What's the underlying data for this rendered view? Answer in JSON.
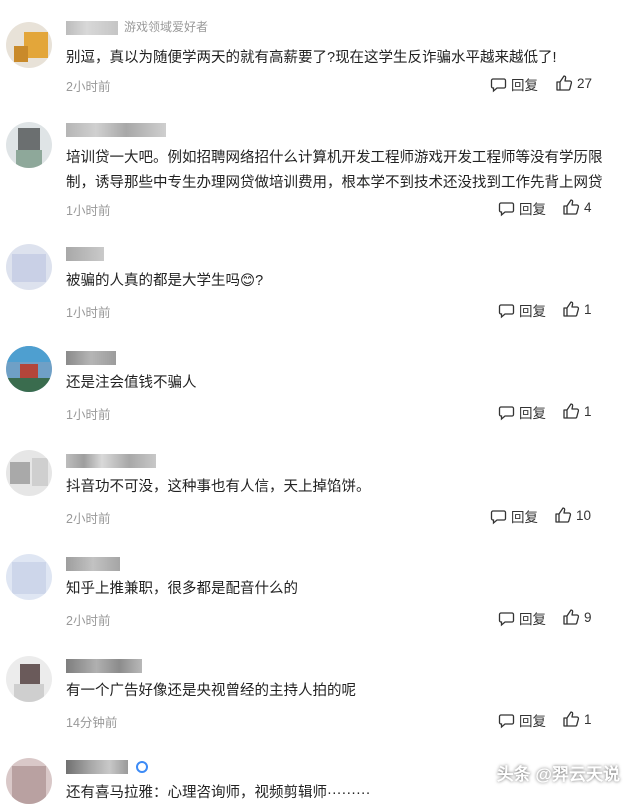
{
  "ui": {
    "reply_label": "回复"
  },
  "comments": [
    {
      "tag": "游戏领域爱好者",
      "text": "别逗，真以为随便学两天的就有高薪要了?现在这学生反诈骗水平越来越低了!",
      "time": "2小时前",
      "likes": "27"
    },
    {
      "tag": "",
      "text": "培训贷一大吧。例如招聘网络招什么计算机开发工程师游戏开发工程师等没有学历限制，诱导那些中专生办理网贷做培训费用，根本学不到技术还没找到工作先背上网贷",
      "time": "1小时前",
      "likes": "4"
    },
    {
      "tag": "",
      "text": "被骗的人真的都是大学生吗😊?",
      "time": "1小时前",
      "likes": "1"
    },
    {
      "tag": "",
      "text": "还是注会值钱不骗人",
      "time": "1小时前",
      "likes": "1"
    },
    {
      "tag": "",
      "text": "抖音功不可没，这种事也有人信，天上掉馅饼。",
      "time": "2小时前",
      "likes": "10"
    },
    {
      "tag": "",
      "text": "知乎上推兼职，很多都是配音什么的",
      "time": "2小时前",
      "likes": "9"
    },
    {
      "tag": "",
      "text": "有一个广告好像还是央视曾经的主持人拍的呢",
      "time": "14分钟前",
      "likes": "1"
    },
    {
      "tag": "",
      "text": "还有喜马拉雅：心理咨询师，视频剪辑师·········",
      "time": "",
      "likes": ""
    }
  ],
  "watermark": "头条 @羿云天说",
  "colors": {
    "text": "#222222",
    "meta": "#999999",
    "background": "#ffffff"
  }
}
